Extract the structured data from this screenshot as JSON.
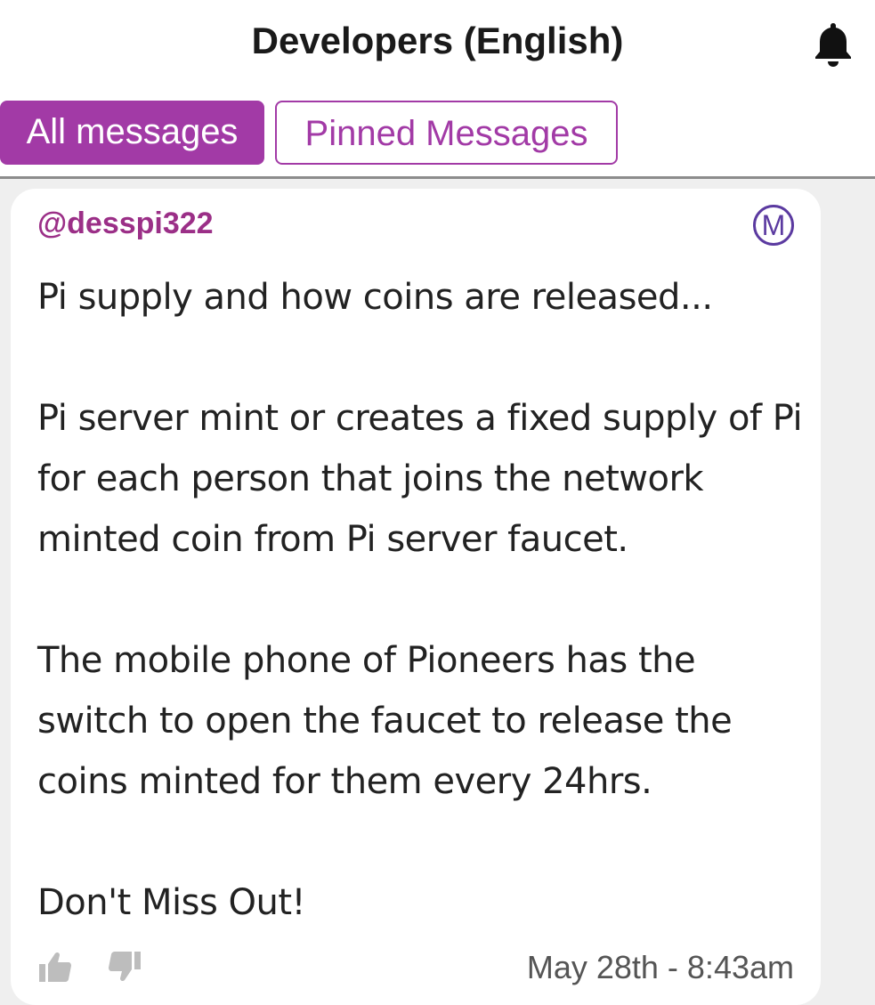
{
  "header": {
    "title": "Developers (English)",
    "notification_icon": "bell-icon"
  },
  "tabs": [
    {
      "label": "All messages",
      "active": true
    },
    {
      "label": "Pinned Messages",
      "active": false
    }
  ],
  "colors": {
    "accent": "#a23aa6",
    "author": "#9b2f87",
    "moderator_badge": "#5b3aa0"
  },
  "message": {
    "author": "@desspi322",
    "badge": "M",
    "text": "Pi supply and how coins are released...\n\nPi server mint or creates a fixed supply of Pi for each person that joins the network minted coin from Pi server faucet.\n\nThe mobile phone of Pioneers has the switch to open the faucet to release the coins minted for them every 24hrs.\n\nDon't Miss Out!",
    "timestamp": "May 28th - 8:43am",
    "upvote_icon": "thumbs-up-icon",
    "downvote_icon": "thumbs-down-icon"
  }
}
